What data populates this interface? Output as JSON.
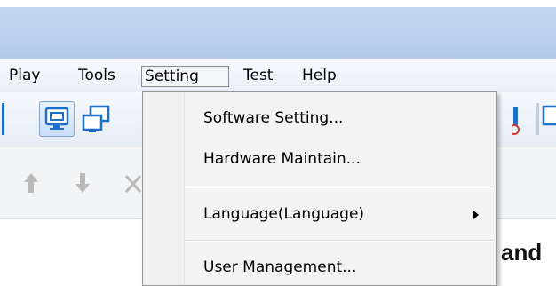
{
  "menubar": {
    "items": [
      {
        "label": "Play"
      },
      {
        "label": "Tools"
      },
      {
        "label": "Setting"
      },
      {
        "label": "Test"
      },
      {
        "label": "Help"
      }
    ]
  },
  "setting_menu": {
    "items": [
      {
        "label": "Software Setting..."
      },
      {
        "label": "Hardware Maintain..."
      },
      {
        "label": "Language(Language)"
      },
      {
        "label": "User Management..."
      }
    ]
  },
  "toolbar": {
    "icons": [
      "display-icon",
      "window-icon",
      "stop-icon",
      "config-icon"
    ]
  },
  "toolbar2": {
    "icons": [
      "arrow-up-icon",
      "arrow-down-icon",
      "close-icon"
    ]
  },
  "content": {
    "partial_text": "and"
  },
  "colors": {
    "titlebar": "#bdd2ec",
    "accent": "#1f6fc5",
    "menu_bg": "#f3f3f3"
  }
}
